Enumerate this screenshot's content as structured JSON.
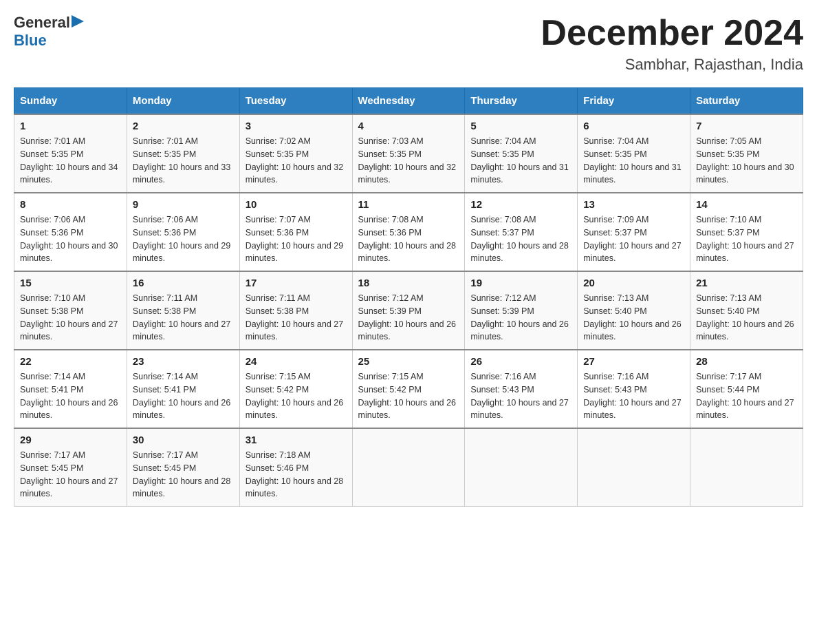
{
  "header": {
    "logo_general": "General",
    "logo_blue": "Blue",
    "month_title": "December 2024",
    "location": "Sambhar, Rajasthan, India"
  },
  "days_of_week": [
    "Sunday",
    "Monday",
    "Tuesday",
    "Wednesday",
    "Thursday",
    "Friday",
    "Saturday"
  ],
  "weeks": [
    [
      {
        "day": "1",
        "sunrise": "7:01 AM",
        "sunset": "5:35 PM",
        "daylight": "10 hours and 34 minutes."
      },
      {
        "day": "2",
        "sunrise": "7:01 AM",
        "sunset": "5:35 PM",
        "daylight": "10 hours and 33 minutes."
      },
      {
        "day": "3",
        "sunrise": "7:02 AM",
        "sunset": "5:35 PM",
        "daylight": "10 hours and 32 minutes."
      },
      {
        "day": "4",
        "sunrise": "7:03 AM",
        "sunset": "5:35 PM",
        "daylight": "10 hours and 32 minutes."
      },
      {
        "day": "5",
        "sunrise": "7:04 AM",
        "sunset": "5:35 PM",
        "daylight": "10 hours and 31 minutes."
      },
      {
        "day": "6",
        "sunrise": "7:04 AM",
        "sunset": "5:35 PM",
        "daylight": "10 hours and 31 minutes."
      },
      {
        "day": "7",
        "sunrise": "7:05 AM",
        "sunset": "5:35 PM",
        "daylight": "10 hours and 30 minutes."
      }
    ],
    [
      {
        "day": "8",
        "sunrise": "7:06 AM",
        "sunset": "5:36 PM",
        "daylight": "10 hours and 30 minutes."
      },
      {
        "day": "9",
        "sunrise": "7:06 AM",
        "sunset": "5:36 PM",
        "daylight": "10 hours and 29 minutes."
      },
      {
        "day": "10",
        "sunrise": "7:07 AM",
        "sunset": "5:36 PM",
        "daylight": "10 hours and 29 minutes."
      },
      {
        "day": "11",
        "sunrise": "7:08 AM",
        "sunset": "5:36 PM",
        "daylight": "10 hours and 28 minutes."
      },
      {
        "day": "12",
        "sunrise": "7:08 AM",
        "sunset": "5:37 PM",
        "daylight": "10 hours and 28 minutes."
      },
      {
        "day": "13",
        "sunrise": "7:09 AM",
        "sunset": "5:37 PM",
        "daylight": "10 hours and 27 minutes."
      },
      {
        "day": "14",
        "sunrise": "7:10 AM",
        "sunset": "5:37 PM",
        "daylight": "10 hours and 27 minutes."
      }
    ],
    [
      {
        "day": "15",
        "sunrise": "7:10 AM",
        "sunset": "5:38 PM",
        "daylight": "10 hours and 27 minutes."
      },
      {
        "day": "16",
        "sunrise": "7:11 AM",
        "sunset": "5:38 PM",
        "daylight": "10 hours and 27 minutes."
      },
      {
        "day": "17",
        "sunrise": "7:11 AM",
        "sunset": "5:38 PM",
        "daylight": "10 hours and 27 minutes."
      },
      {
        "day": "18",
        "sunrise": "7:12 AM",
        "sunset": "5:39 PM",
        "daylight": "10 hours and 26 minutes."
      },
      {
        "day": "19",
        "sunrise": "7:12 AM",
        "sunset": "5:39 PM",
        "daylight": "10 hours and 26 minutes."
      },
      {
        "day": "20",
        "sunrise": "7:13 AM",
        "sunset": "5:40 PM",
        "daylight": "10 hours and 26 minutes."
      },
      {
        "day": "21",
        "sunrise": "7:13 AM",
        "sunset": "5:40 PM",
        "daylight": "10 hours and 26 minutes."
      }
    ],
    [
      {
        "day": "22",
        "sunrise": "7:14 AM",
        "sunset": "5:41 PM",
        "daylight": "10 hours and 26 minutes."
      },
      {
        "day": "23",
        "sunrise": "7:14 AM",
        "sunset": "5:41 PM",
        "daylight": "10 hours and 26 minutes."
      },
      {
        "day": "24",
        "sunrise": "7:15 AM",
        "sunset": "5:42 PM",
        "daylight": "10 hours and 26 minutes."
      },
      {
        "day": "25",
        "sunrise": "7:15 AM",
        "sunset": "5:42 PM",
        "daylight": "10 hours and 26 minutes."
      },
      {
        "day": "26",
        "sunrise": "7:16 AM",
        "sunset": "5:43 PM",
        "daylight": "10 hours and 27 minutes."
      },
      {
        "day": "27",
        "sunrise": "7:16 AM",
        "sunset": "5:43 PM",
        "daylight": "10 hours and 27 minutes."
      },
      {
        "day": "28",
        "sunrise": "7:17 AM",
        "sunset": "5:44 PM",
        "daylight": "10 hours and 27 minutes."
      }
    ],
    [
      {
        "day": "29",
        "sunrise": "7:17 AM",
        "sunset": "5:45 PM",
        "daylight": "10 hours and 27 minutes."
      },
      {
        "day": "30",
        "sunrise": "7:17 AM",
        "sunset": "5:45 PM",
        "daylight": "10 hours and 28 minutes."
      },
      {
        "day": "31",
        "sunrise": "7:18 AM",
        "sunset": "5:46 PM",
        "daylight": "10 hours and 28 minutes."
      },
      null,
      null,
      null,
      null
    ]
  ],
  "labels": {
    "sunrise": "Sunrise:",
    "sunset": "Sunset:",
    "daylight": "Daylight:"
  }
}
